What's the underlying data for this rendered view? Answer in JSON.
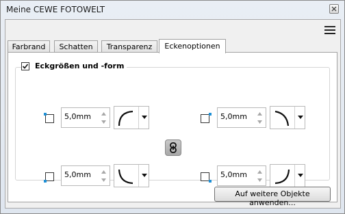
{
  "window": {
    "title": "Meine CEWE FOTOWELT"
  },
  "tabs": [
    {
      "label": "Farbrand",
      "active": false
    },
    {
      "label": "Schatten",
      "active": false
    },
    {
      "label": "Transparenz",
      "active": false
    },
    {
      "label": "Eckenoptionen",
      "active": true
    }
  ],
  "group": {
    "checked": true,
    "title": "Eckgrößen und -form"
  },
  "corners": {
    "top_left": {
      "value": "5,0mm",
      "shape": "round-convex",
      "position": "top-left"
    },
    "top_right": {
      "value": "5,0mm",
      "shape": "round-concave",
      "position": "top-right"
    },
    "bottom_left": {
      "value": "5,0mm",
      "shape": "round-convex",
      "position": "bottom-left"
    },
    "bottom_right": {
      "value": "5,0mm",
      "shape": "round-convex",
      "position": "bottom-right"
    }
  },
  "link_button": {
    "icon": "chain-link-icon",
    "linked": true
  },
  "apply_button": {
    "label": "Auf weitere Objekte anwenden..."
  },
  "colors": {
    "accent": "#1e90d6",
    "link_button": "#b0b0b0"
  }
}
